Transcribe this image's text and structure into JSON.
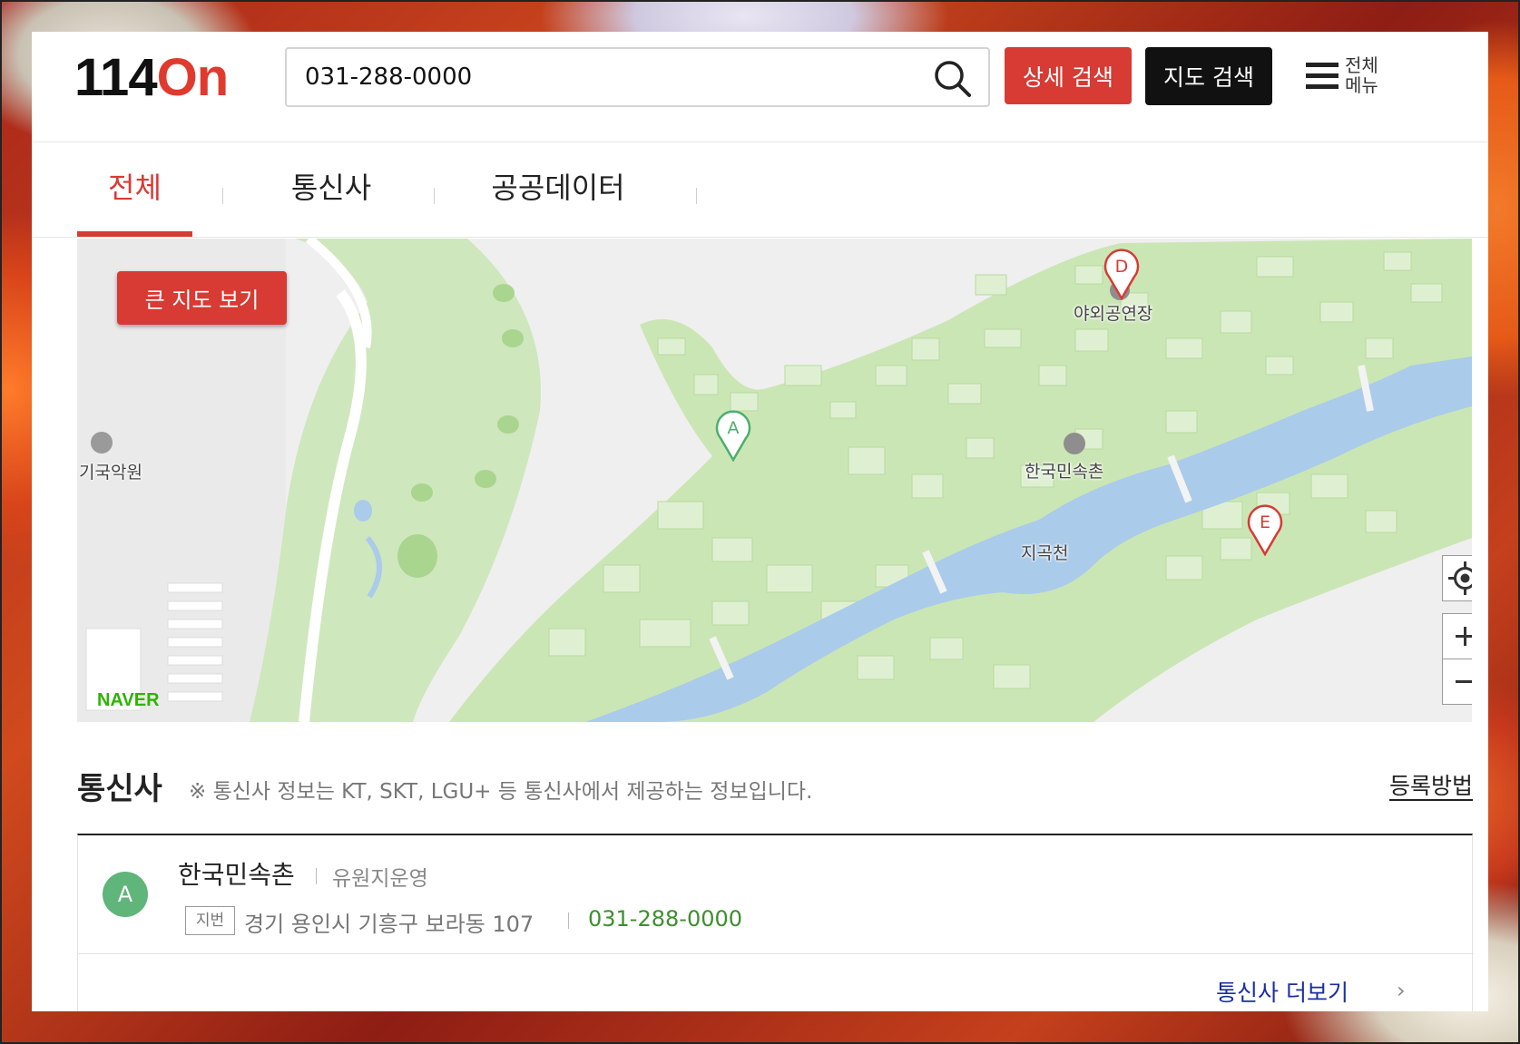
{
  "header": {
    "logo_number": "114",
    "logo_on": "On",
    "search_value": "031-288-0000",
    "detail_search_label": "상세 검색",
    "map_search_label": "지도 검색",
    "menu_label": "전체 메뉴"
  },
  "tabs": [
    {
      "label": "전체",
      "active": true
    },
    {
      "label": "통신사",
      "active": false
    },
    {
      "label": "공공데이터",
      "active": false
    }
  ],
  "map": {
    "big_map_button": "큰 지도 보기",
    "labels": {
      "outdoor_stage": "야외공연장",
      "folk_village": "한국민속촌",
      "stream": "지곡천",
      "academy": "기국악원"
    },
    "markers": [
      {
        "letter": "A",
        "color": "#4caf6b"
      },
      {
        "letter": "D",
        "color": "#d83a34"
      },
      {
        "letter": "E",
        "color": "#d83a34"
      }
    ],
    "brand": "NAVER",
    "controls": {
      "locate": "locate-icon",
      "zoom_in": "+",
      "zoom_out": "−"
    }
  },
  "carrier_section": {
    "title": "통신사",
    "note": "※ 통신사 정보는 KT, SKT, LGU+ 등 통신사에서 제공하는 정보입니다.",
    "register_link": "등록방법",
    "items": [
      {
        "badge": "A",
        "name": "한국민속촌",
        "category": "유원지운영",
        "address_tag": "지번",
        "address": "경기 용인시 기흥구 보라동 107",
        "phone": "031-288-0000"
      }
    ],
    "more_link": "통신사 더보기"
  },
  "colors": {
    "accent_red": "#d83a34",
    "phone_green": "#3d8f2e",
    "link_blue": "#1a2fa0",
    "map_green": "#cbe6b5",
    "map_water": "#aacbea"
  }
}
